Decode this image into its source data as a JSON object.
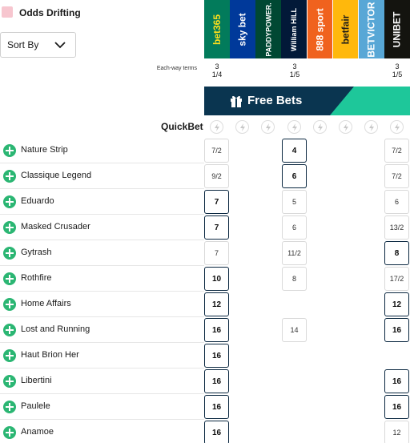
{
  "header": {
    "odds_drifting_label": "Odds Drifting",
    "sort_label": "Sort By"
  },
  "bookmakers": [
    {
      "name": "bet365",
      "bg": "#027b5b",
      "fg": "#ffdf1b"
    },
    {
      "name": "sky bet",
      "bg": "#00399a",
      "fg": "#ffffff"
    },
    {
      "name": "PADDYPOWER.",
      "bg": "#004833",
      "fg": "#ffffff"
    },
    {
      "name": "William HILL",
      "bg": "#021938",
      "fg": "#ffffff"
    },
    {
      "name": "888 sport",
      "bg": "#f0621e",
      "fg": "#ffffff"
    },
    {
      "name": "betfair",
      "bg": "#ffb80c",
      "fg": "#1a1a1a"
    },
    {
      "name": "BETVICTOR",
      "bg": "#58a7d6",
      "fg": "#ffffff"
    },
    {
      "name": "UNIBET",
      "bg": "#14140f",
      "fg": "#ffffff"
    }
  ],
  "each_way": {
    "label": "Each-way terms",
    "terms": [
      {
        "col": 0,
        "places": "3",
        "fraction": "1/4"
      },
      {
        "col": 3,
        "places": "3",
        "fraction": "1/5"
      },
      {
        "col": 7,
        "places": "3",
        "fraction": "1/5"
      }
    ]
  },
  "free_bets_label": "Free Bets",
  "quickbet_label": "QuickBet",
  "runners": [
    {
      "name": "Nature Strip",
      "odds": [
        {
          "col": 0,
          "v": "7/2"
        },
        {
          "col": 3,
          "v": "4",
          "best": true
        },
        {
          "col": 7,
          "v": "7/2"
        }
      ]
    },
    {
      "name": "Classique Legend",
      "odds": [
        {
          "col": 0,
          "v": "9/2"
        },
        {
          "col": 3,
          "v": "6",
          "best": true
        },
        {
          "col": 7,
          "v": "7/2"
        }
      ]
    },
    {
      "name": "Eduardo",
      "odds": [
        {
          "col": 0,
          "v": "7",
          "best": true
        },
        {
          "col": 3,
          "v": "5"
        },
        {
          "col": 7,
          "v": "6"
        }
      ]
    },
    {
      "name": "Masked Crusader",
      "odds": [
        {
          "col": 0,
          "v": "7",
          "best": true
        },
        {
          "col": 3,
          "v": "6"
        },
        {
          "col": 7,
          "v": "13/2"
        }
      ]
    },
    {
      "name": "Gytrash",
      "odds": [
        {
          "col": 0,
          "v": "7"
        },
        {
          "col": 3,
          "v": "11/2"
        },
        {
          "col": 7,
          "v": "8",
          "best": true
        }
      ]
    },
    {
      "name": "Rothfire",
      "odds": [
        {
          "col": 0,
          "v": "10",
          "best": true
        },
        {
          "col": 3,
          "v": "8"
        },
        {
          "col": 7,
          "v": "17/2"
        }
      ]
    },
    {
      "name": "Home Affairs",
      "odds": [
        {
          "col": 0,
          "v": "12",
          "best": true
        },
        {
          "col": 7,
          "v": "12",
          "best": true
        }
      ]
    },
    {
      "name": "Lost and Running",
      "odds": [
        {
          "col": 0,
          "v": "16",
          "best": true
        },
        {
          "col": 3,
          "v": "14"
        },
        {
          "col": 7,
          "v": "16",
          "best": true
        }
      ]
    },
    {
      "name": "Haut Brion Her",
      "odds": [
        {
          "col": 0,
          "v": "16",
          "best": true
        }
      ]
    },
    {
      "name": "Libertini",
      "odds": [
        {
          "col": 0,
          "v": "16",
          "best": true
        },
        {
          "col": 7,
          "v": "16",
          "best": true
        }
      ]
    },
    {
      "name": "Paulele",
      "odds": [
        {
          "col": 0,
          "v": "16",
          "best": true
        },
        {
          "col": 7,
          "v": "16",
          "best": true
        }
      ]
    },
    {
      "name": "Anamoe",
      "odds": [
        {
          "col": 0,
          "v": "16",
          "best": true
        },
        {
          "col": 7,
          "v": "12"
        }
      ]
    }
  ]
}
